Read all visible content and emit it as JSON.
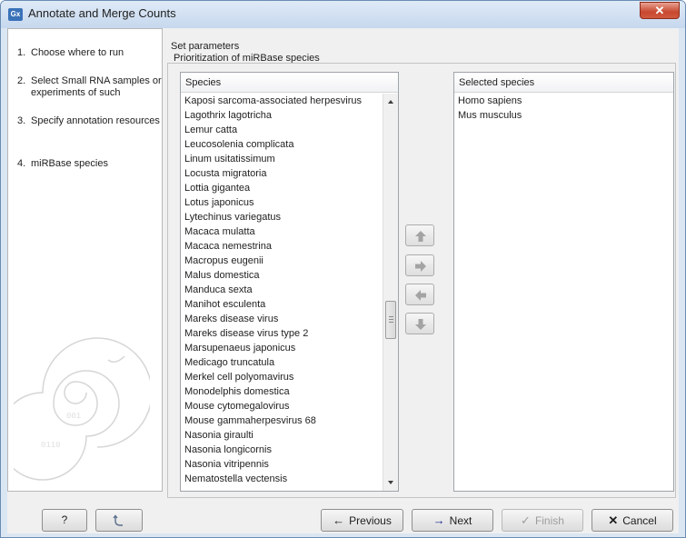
{
  "window": {
    "title": "Annotate and Merge Counts",
    "app_icon_text": "Gx",
    "close_glyph": "✕"
  },
  "steps": [
    {
      "num": "1.",
      "label": "Choose where to run"
    },
    {
      "num": "2.",
      "label": "Select Small RNA samples or experiments of such"
    },
    {
      "num": "3.",
      "label": "Specify annotation resources"
    },
    {
      "num": "4.",
      "label": "miRBase species"
    }
  ],
  "params": {
    "section_title": "Set parameters",
    "group_title": "Prioritization of miRBase species"
  },
  "species_list": {
    "header": "Species",
    "items": [
      "Kaposi sarcoma-associated herpesvirus",
      "Lagothrix lagotricha",
      "Lemur catta",
      "Leucosolenia complicata",
      "Linum usitatissimum",
      "Locusta migratoria",
      "Lottia gigantea",
      "Lotus japonicus",
      "Lytechinus variegatus",
      "Macaca mulatta",
      "Macaca nemestrina",
      "Macropus eugenii",
      "Malus domestica",
      "Manduca sexta",
      "Manihot esculenta",
      "Mareks disease virus",
      "Mareks disease virus type 2",
      "Marsupenaeus japonicus",
      "Medicago truncatula",
      "Merkel cell polyomavirus",
      "Monodelphis domestica",
      "Mouse cytomegalovirus",
      "Mouse gammaherpesvirus 68",
      "Nasonia giraulti",
      "Nasonia longicornis",
      "Nasonia vitripennis",
      "Nematostella vectensis"
    ]
  },
  "selected_list": {
    "header": "Selected species",
    "items": [
      "Homo sapiens",
      "Mus musculus"
    ]
  },
  "move_buttons": [
    {
      "name": "move-up-button",
      "icon": "arrow-up-icon"
    },
    {
      "name": "add-to-selected-button",
      "icon": "arrow-right-icon"
    },
    {
      "name": "remove-from-selected-button",
      "icon": "arrow-left-icon"
    },
    {
      "name": "move-down-button",
      "icon": "arrow-down-icon"
    }
  ],
  "footer": {
    "help_label": "?",
    "reset_icon": "reset-icon",
    "previous_label": "Previous",
    "next_label": "Next",
    "finish_label": "Finish",
    "cancel_label": "Cancel"
  },
  "colors": {
    "move_arrow": "#9a9a9a",
    "next_arrow": "#1a2a8a",
    "cancel_x": "#1c1c1c"
  }
}
